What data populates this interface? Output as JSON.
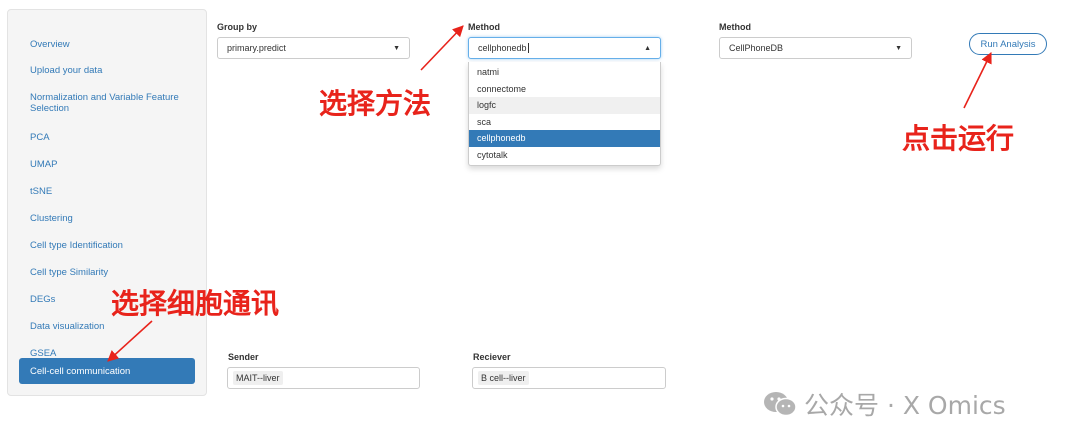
{
  "sidebar": {
    "items": [
      {
        "label": "Overview"
      },
      {
        "label": "Upload your data"
      },
      {
        "label": "Normalization and Variable Feature Selection"
      },
      {
        "label": "PCA"
      },
      {
        "label": "UMAP"
      },
      {
        "label": "tSNE"
      },
      {
        "label": "Clustering"
      },
      {
        "label": "Cell type Identification"
      },
      {
        "label": "Cell type Similarity"
      },
      {
        "label": "DEGs"
      },
      {
        "label": "Data visualization"
      },
      {
        "label": "GSEA"
      },
      {
        "label": "Cell-cell communication",
        "active": true
      }
    ]
  },
  "controls": {
    "group_by": {
      "label": "Group by",
      "value": "primary.predict"
    },
    "method1": {
      "label": "Method",
      "value": "cellphonedb",
      "options": [
        "natmi",
        "connectome",
        "logfc",
        "sca",
        "cellphonedb",
        "cytotalk"
      ],
      "hover_option": "logfc",
      "selected_option": "cellphonedb"
    },
    "method2": {
      "label": "Method",
      "value": "CellPhoneDB"
    },
    "run_button": "Run Analysis",
    "sender": {
      "label": "Sender",
      "value": "MAIT--liver"
    },
    "receiver": {
      "label": "Reciever",
      "value": "B cell--liver"
    }
  },
  "annotations": {
    "select_method": "选择方法",
    "click_run": "点击运行",
    "select_comm": "选择细胞通讯"
  },
  "watermark": "公众号 · X Omics",
  "colors": {
    "accent": "#337ab7",
    "annotation": "#e8231b"
  }
}
